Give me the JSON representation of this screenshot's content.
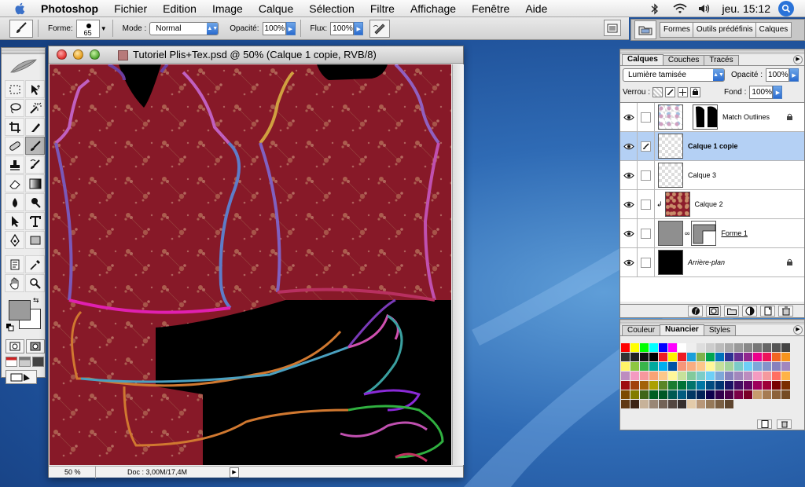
{
  "menubar": {
    "app": "Photoshop",
    "items": [
      "Fichier",
      "Edition",
      "Image",
      "Calque",
      "Sélection",
      "Filtre",
      "Affichage",
      "Fenêtre",
      "Aide"
    ],
    "clock": "jeu. 15:12"
  },
  "options": {
    "brush_label": "Forme:",
    "brush_size": "65",
    "mode_label": "Mode :",
    "mode_value": "Normal",
    "opacity_label": "Opacité:",
    "opacity_value": "100%",
    "flow_label": "Flux:",
    "flow_value": "100%"
  },
  "well": {
    "tabs": [
      "Formes",
      "Outils prédéfinis",
      "Calques"
    ]
  },
  "document": {
    "title": "Tutoriel Plis+Tex.psd @ 50% (Calque 1 copie, RVB/8)",
    "zoom": "50 %",
    "info": "Doc : 3,00M/17,4M"
  },
  "layers_palette": {
    "tabs": [
      "Calques",
      "Couches",
      "Tracés"
    ],
    "blend_mode": "Lumière tamisée",
    "opacity_label": "Opacité :",
    "opacity_value": "100%",
    "lock_label": "Verrou :",
    "fill_label": "Fond :",
    "fill_value": "100%",
    "layers": [
      {
        "name": "Match Outlines",
        "visible": true,
        "selected": false
      },
      {
        "name": "Calque 1 copie",
        "visible": true,
        "selected": true
      },
      {
        "name": "Calque 3",
        "visible": true,
        "selected": false
      },
      {
        "name": "Calque 2",
        "visible": true,
        "selected": false
      },
      {
        "name": "Forme 1",
        "visible": true,
        "selected": false
      },
      {
        "name": "Arrière-plan",
        "visible": true,
        "selected": false
      }
    ]
  },
  "swatches_palette": {
    "tabs": [
      "Couleur",
      "Nuancier",
      "Styles"
    ],
    "colors": [
      "#ff0000",
      "#ffff00",
      "#00ff00",
      "#00ffff",
      "#0000ff",
      "#ff00ff",
      "#ffffff",
      "#eeeeee",
      "#dddddd",
      "#cccccc",
      "#bbbbbb",
      "#aaaaaa",
      "#999999",
      "#888888",
      "#777777",
      "#666666",
      "#555555",
      "#444444",
      "#333333",
      "#222222",
      "#111111",
      "#000000",
      "#ee1c24",
      "#fff200",
      "#ed1c24",
      "#1a9fd9",
      "#7fb24b",
      "#00a651",
      "#0072bc",
      "#2e3192",
      "#662d91",
      "#92278f",
      "#ec008c",
      "#ed145b",
      "#f26522",
      "#f7941d",
      "#fff568",
      "#8dc63f",
      "#39b54a",
      "#00a99d",
      "#00aeef",
      "#0054a6",
      "#f69679",
      "#f9ad81",
      "#fdc68a",
      "#fff799",
      "#c4df9b",
      "#a3d39c",
      "#7accc8",
      "#6dcff6",
      "#7da7d9",
      "#8493ca",
      "#8781bd",
      "#a187be",
      "#bd8cbf",
      "#f49ac1",
      "#f6989d",
      "#f9a375",
      "#fcc88a",
      "#fff79a",
      "#c7e19b",
      "#82ca9c",
      "#7bcdc8",
      "#6ecff6",
      "#7ea7d8",
      "#8782bd",
      "#a287bc",
      "#bc8cbf",
      "#f49bc1",
      "#f5999e",
      "#ff6f61",
      "#ffb347",
      "#9e0b0f",
      "#a0410d",
      "#a36209",
      "#aba000",
      "#598527",
      "#1a7b30",
      "#007236",
      "#00746b",
      "#0076a3",
      "#004b80",
      "#003471",
      "#1b1464",
      "#440e62",
      "#630460",
      "#9e005d",
      "#9e0039",
      "#790000",
      "#7b2e00",
      "#7d4900",
      "#827b00",
      "#406618",
      "#005e20",
      "#005826",
      "#005952",
      "#005b7f",
      "#003663",
      "#002157",
      "#0d004c",
      "#32004b",
      "#4b0049",
      "#7b0046",
      "#7a0026",
      "#c69c6d",
      "#a67c52",
      "#8c6239",
      "#754c24",
      "#603913",
      "#3c2415",
      "#c7b299",
      "#998675",
      "#736357",
      "#534741",
      "#362f2d",
      "#e3cbaa",
      "#b89778",
      "#967959",
      "#7a5f43",
      "#5e452e"
    ]
  }
}
